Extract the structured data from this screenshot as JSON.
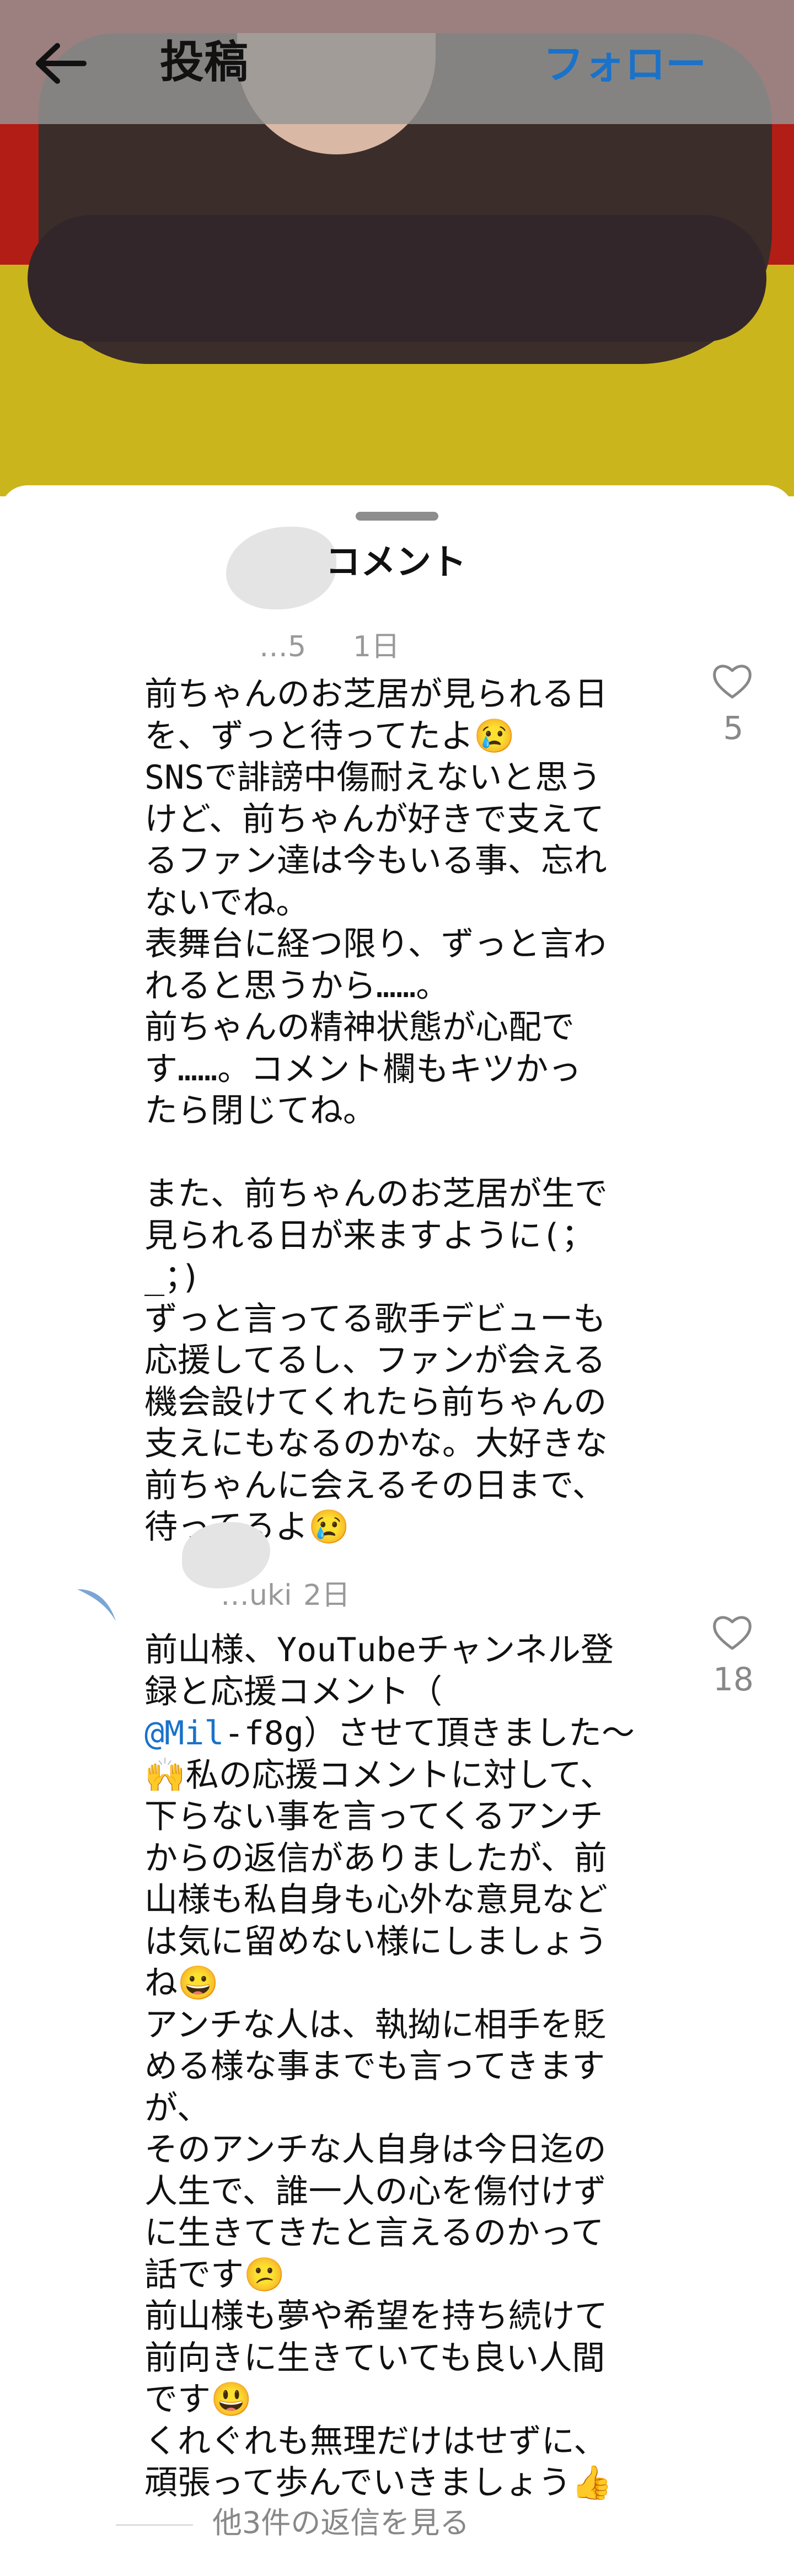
{
  "header": {
    "title": "投稿",
    "follow_label": "フォロー",
    "back_icon": "arrow-left-icon"
  },
  "sheet": {
    "title": "コメント"
  },
  "comments": [
    {
      "username": "…5",
      "time": "1日",
      "likes": "5",
      "lines": [
        "前ちゃんのお芝居が見られる日",
        "を、ずっと待ってたよ😢",
        "SNSで誹謗中傷耐えないと思う",
        "けど、前ちゃんが好きで支えて",
        "るファン達は今もいる事、忘れ",
        "ないでね。",
        "表舞台に経つ限り、ずっと言わ",
        "れると思うから……。",
        "前ちゃんの精神状態が心配で",
        "す……。コメント欄もキツかっ",
        "たら閉じてね。",
        "",
        "また、前ちゃんのお芝居が生で",
        "見られる日が来ますように(；",
        "_；)",
        "ずっと言ってる歌手デビューも",
        "応援してるし、ファンが会える",
        "機会設けてくれたら前ちゃんの",
        "支えにもなるのかな。大好きな",
        "前ちゃんに会えるその日まで、",
        "待ってるよ😢"
      ]
    },
    {
      "username": "…uki",
      "time": "2日",
      "likes": "18",
      "mention": "@Mil",
      "lines": [
        "前山様、YouTubeチャンネル登",
        "録と応援コメント（",
        "@Mil-f8g）させて頂きました〜",
        "🙌私の応援コメントに対して、",
        "下らない事を言ってくるアンチ",
        "からの返信がありましたが、前",
        "山様も私自身も心外な意見など",
        "は気に留めない様にしましょう",
        "ね😀",
        "アンチな人は、執拗に相手を貶",
        "める様な事までも言ってきます",
        "が、",
        "そのアンチな人自身は今日迄の",
        "人生で、誰一人の心を傷付けず",
        "に生きてきたと言えるのかって",
        "話です😕",
        "前山様も夢や希望を持ち続けて",
        "前向きに生きていても良い人間",
        "です😃",
        "くれぐれも無理だけはせずに、",
        "頑張って歩んでいきましょう👍"
      ]
    }
  ],
  "view_replies_label": "他3件の返信を見る",
  "icons": [
    "arrow-left-icon",
    "heart-outline-icon"
  ],
  "colors": {
    "accent": "#1a72c9",
    "header_bg": "#969696"
  }
}
